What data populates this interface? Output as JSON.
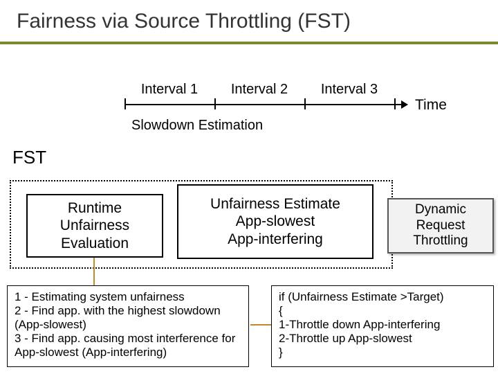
{
  "title": "Fairness via Source Throttling (FST)",
  "timeline": {
    "intervals": [
      "Interval 1",
      "Interval 2",
      "Interval 3"
    ],
    "time_label": "Time",
    "slowdown_estimation": "Slowdown\nEstimation"
  },
  "fst_label": "FST",
  "boxes": {
    "left": "Runtime\nUnfairness\nEvaluation",
    "center": "Unfairness Estimate\nApp-slowest\nApp-interfering",
    "right": "Dynamic\nRequest Throttling"
  },
  "notes": {
    "left": "1 - Estimating system unfairness\n2 - Find app. with the highest slowdown (App-slowest)\n3 - Find app. causing most interference for App-slowest (App-interfering)",
    "right": "if (Unfairness Estimate >Target)\n{\n  1-Throttle down App-interfering\n  2-Throttle up App-slowest\n}"
  }
}
